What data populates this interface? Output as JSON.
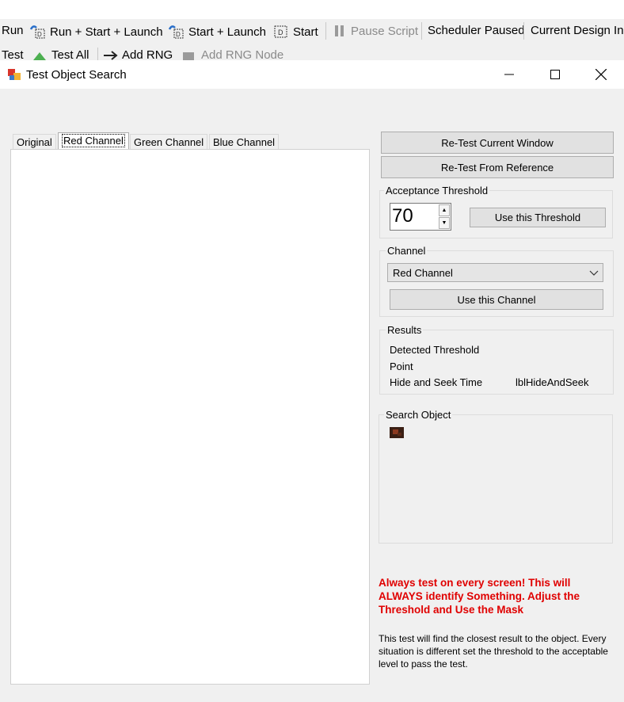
{
  "toolbar": {
    "row1": [
      {
        "label": "Run",
        "icon": "run-icon"
      },
      {
        "label": "Run + Start + Launch",
        "icon": "run-start-launch-icon"
      },
      {
        "label": "Start + Launch",
        "icon": "start-launch-icon"
      },
      {
        "label": "Start",
        "icon": "start-icon"
      },
      {
        "label": "Pause Script",
        "icon": "pause-icon",
        "disabled": true
      },
      {
        "label": "Scheduler Paused"
      },
      {
        "label": "Current Design Ins"
      }
    ],
    "row2": [
      {
        "label": "Test"
      },
      {
        "label": "Test All",
        "icon": "test-all-icon"
      },
      {
        "label": "Add RNG",
        "icon": "add-rng-icon"
      },
      {
        "label": "Add RNG Node",
        "icon": "add-rng-node-icon",
        "disabled": true
      }
    ]
  },
  "window": {
    "title": "Test Object Search",
    "icon": "app-icon"
  },
  "tabs": [
    "Original",
    "Red Channel",
    "Green Channel",
    "Blue Channel"
  ],
  "active_tab": "Red Channel",
  "buttons": {
    "retest_current": "Re-Test Current Window",
    "retest_reference": "Re-Test From Reference",
    "use_threshold": "Use this Threshold",
    "use_channel": "Use this Channel"
  },
  "acceptance": {
    "label": "Acceptance Threshold",
    "value": "70"
  },
  "channel": {
    "label": "Channel",
    "selected": "Red Channel"
  },
  "results": {
    "label": "Results",
    "detected_threshold": "Detected Threshold",
    "point": "Point",
    "hide_seek_time": "Hide and Seek Time",
    "hide_seek_value": "lblHideAndSeek"
  },
  "search_object": {
    "label": "Search Object"
  },
  "warning": "Always test on every screen!  This will ALWAYS identify Something.  Adjust the Threshold and Use the Mask",
  "info": "This test will find the closest result to the object. Every situation is different set the threshold to the acceptable level to pass the test.",
  "colors": {
    "warning": "#e00000",
    "dialog_bg": "#f0f0f0",
    "button_bg": "#e1e1e1"
  }
}
